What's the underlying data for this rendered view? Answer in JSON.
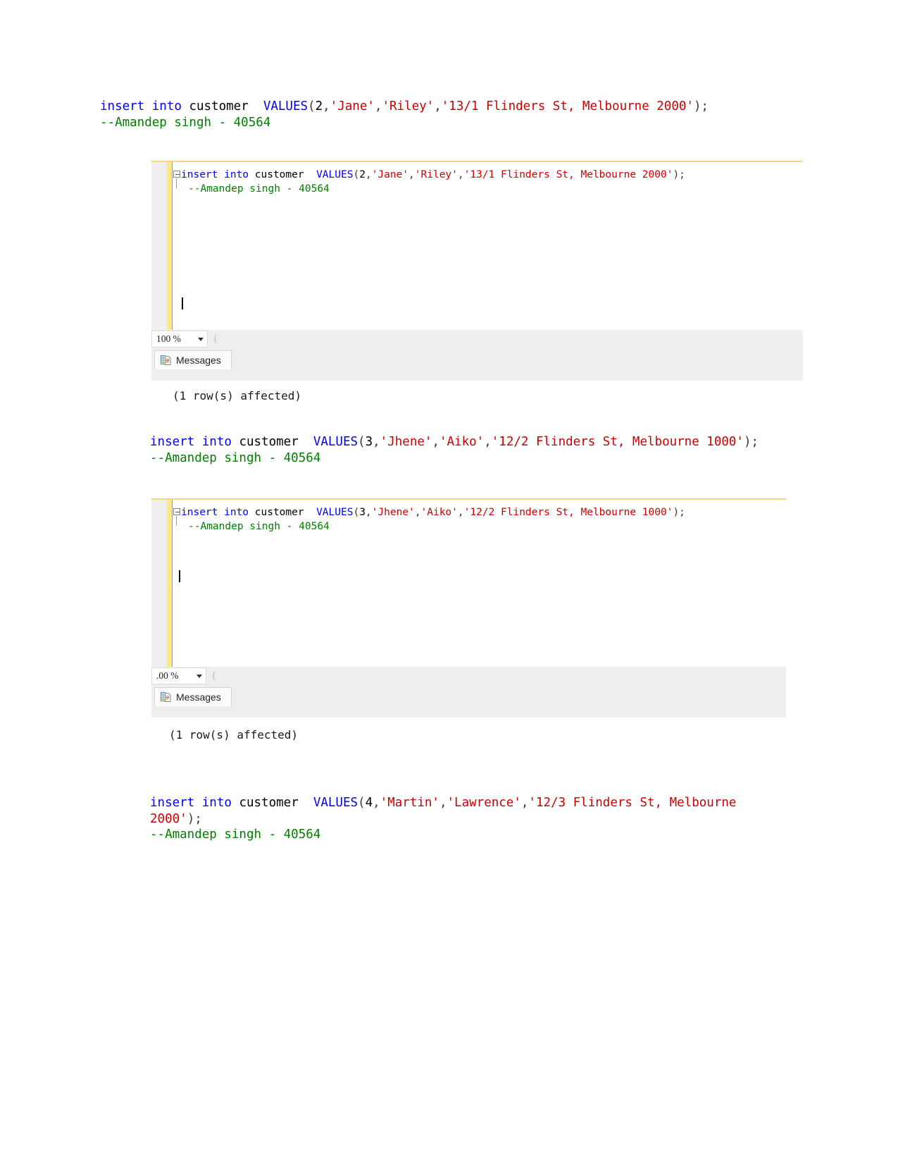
{
  "document": {
    "snippets": [
      {
        "id": "snippet-1",
        "kw_insert": "insert into",
        "table": " customer  ",
        "kw_values": "VALUES",
        "open": "(",
        "id_value": "2",
        "comma1": ",",
        "first_name": "'Jane'",
        "comma2": ",",
        "last_name": "'Riley'",
        "comma3": ",",
        "address": "'13/1 Flinders St, Melbourne 2000'",
        "close": ");",
        "comment": "--Amandep singh - 40564"
      },
      {
        "id": "snippet-2",
        "kw_insert": "insert into",
        "table": " customer  ",
        "kw_values": "VALUES",
        "open": "(",
        "id_value": "3",
        "comma1": ",",
        "first_name": "'Jhene'",
        "comma2": ",",
        "last_name": "'Aiko'",
        "comma3": ",",
        "address": "'12/2 Flinders St, Melbourne 1000'",
        "close": ");",
        "comment": "--Amandep singh - 40564"
      },
      {
        "id": "snippet-3",
        "kw_insert": "insert into",
        "table": " customer  ",
        "kw_values": "VALUES",
        "open": "(",
        "id_value": "4",
        "comma1": ",",
        "first_name": "'Martin'",
        "comma2": ",",
        "last_name": "'Lawrence'",
        "comma3": ",",
        "address": "'12/3 Flinders St, Melbourne 2000'",
        "close": ");",
        "comment": "--Amandep singh - 40564"
      }
    ]
  },
  "ssms_windows": [
    {
      "id": "ssms-window-1",
      "editor": {
        "line1": {
          "kw_insert": "insert into",
          "table": " customer  ",
          "kw_values": "VALUES",
          "open": "(",
          "id_value": "2",
          "comma1": ",",
          "first_name": "'Jane'",
          "comma2": ",",
          "last_name": "'Riley'",
          "comma3": ",",
          "address": "'13/1 Flinders St, Melbourne 2000'",
          "close": ");"
        },
        "line2_comment": "--Amandep singh - 40564"
      },
      "zoom_level": "100 %",
      "tab_label": "Messages",
      "tab_icon": "messages-icon",
      "output_text": "(1 row(s) affected)"
    },
    {
      "id": "ssms-window-2",
      "editor": {
        "line1": {
          "kw_insert": "insert into",
          "table": " customer  ",
          "kw_values": "VALUES",
          "open": "(",
          "id_value": "3",
          "comma1": ",",
          "first_name": "'Jhene'",
          "comma2": ",",
          "last_name": "'Aiko'",
          "comma3": ",",
          "address": "'12/2 Flinders St, Melbourne 1000'",
          "close": ");"
        },
        "line2_comment": "--Amandep singh - 40564"
      },
      "zoom_level": ".00 %",
      "tab_label": "Messages",
      "tab_icon": "messages-icon",
      "output_text": "(1 row(s) affected)"
    }
  ],
  "colors": {
    "keyword": "#0000ff",
    "string": "#ce0000",
    "comment": "#008000",
    "plain": "#000000",
    "change_bar": "#ffe97f",
    "top_rule": "#f2d97a"
  }
}
